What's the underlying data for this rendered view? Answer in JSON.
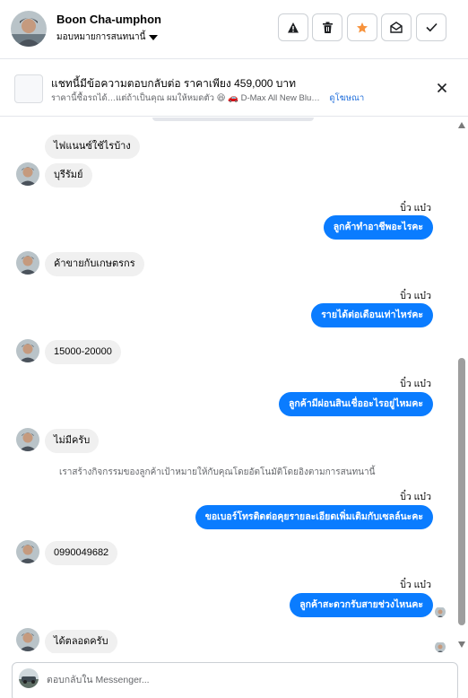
{
  "header": {
    "contact_name": "Boon Cha-umphon",
    "assign_label": "มอบหมายการสนทนานี้",
    "actions": [
      "warning-icon",
      "trash-icon",
      "star-icon",
      "mark-unread-icon",
      "check-icon"
    ],
    "star_color": "#f7923b"
  },
  "banner": {
    "title": "แชทนี้มีข้อความตอบกลับต่อ ราคาเพียง 459,000 บาท",
    "subtitle": "ราคานี้ซื้อรถได้…แต่ถ้าเป็นคุณ ผมให้หมดตัว 😆 🚗 D-Max All New Blu…",
    "link": "ดูโฆษณา"
  },
  "colors": {
    "outgoing_bubble": "#0a7cff",
    "incoming_bubble": "#f0f0f0"
  },
  "messages": {
    "m1": "ไฟแนนซ์ใช้ไรบ้าง",
    "m2": "บุรีรัมย์",
    "s1": "บิ๋ว แบ๋ว",
    "m3": "ลูกค้าทำอาชีพอะไรคะ",
    "m4": "ค้าขายกับเกษตรกร",
    "s2": "บิ๋ว แบ๋ว",
    "m5": "รายได้ต่อเดือนเท่าไหร่คะ",
    "m6": "15000-20000",
    "s3": "บิ๋ว แบ๋ว",
    "m7": "ลูกค้ามีผ่อนสินเชื่ออะไรอยู่ไหมคะ",
    "m8": "ไม่มีครับ",
    "system": "เราสร้างกิจกรรมของลูกค้าเป้าหมายให้กับคุณโดยอัตโนมัติโดยอิงตามการสนทนานี้",
    "s4": "บิ๋ว แบ๋ว",
    "m9": "ขอเบอร์โทรติดต่อคุยรายละเอียดเพิ่มเติมกับเซลล์นะคะ",
    "m10": "0990049682",
    "s5": "บิ๋ว แบ๋ว",
    "m11": "ลูกค้าสะดวกรับสายช่วงไหนคะ",
    "m12": "ได้ตลอดครับ"
  },
  "composer": {
    "placeholder": "ตอบกลับใน Messenger..."
  }
}
